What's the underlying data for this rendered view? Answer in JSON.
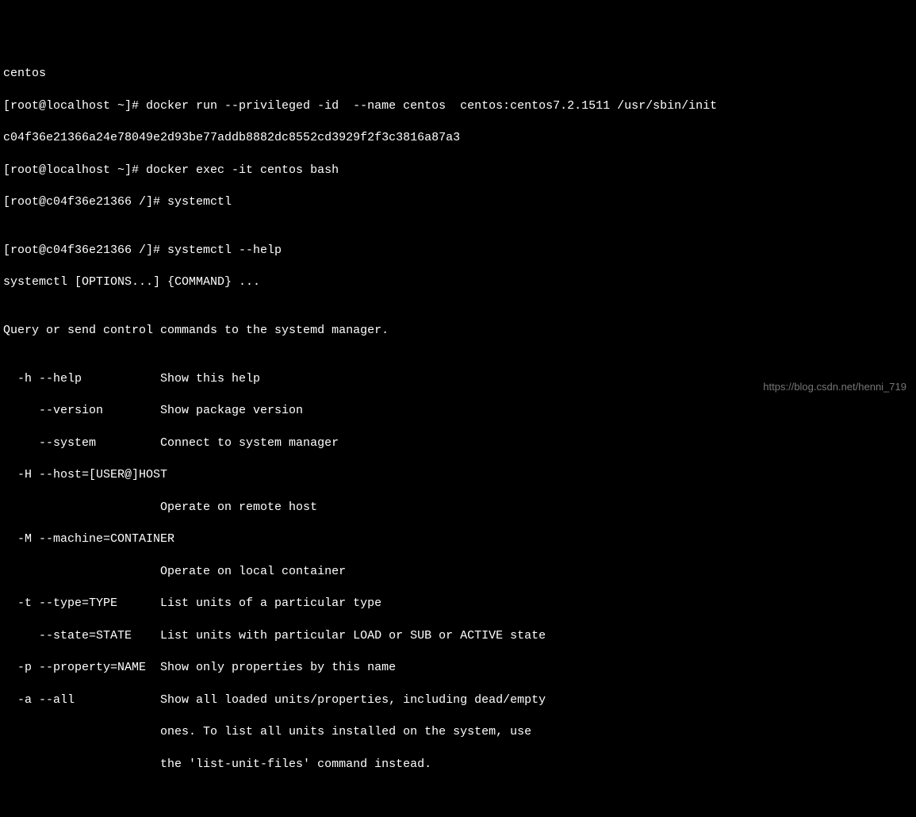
{
  "lines": {
    "l0": "centos",
    "l1": "[root@localhost ~]# docker run --privileged -id  --name centos  centos:centos7.2.1511 /usr/sbin/init",
    "l2": "c04f36e21366a24e78049e2d93be77addb8882dc8552cd3929f2f3c3816a87a3",
    "l3": "[root@localhost ~]# docker exec -it centos bash",
    "l4": "[root@c04f36e21366 /]# systemctl",
    "l5": "",
    "l6": "[root@c04f36e21366 /]# systemctl --help",
    "l7": "systemctl [OPTIONS...] {COMMAND} ...",
    "l8": "",
    "l9": "Query or send control commands to the systemd manager.",
    "l10": "",
    "l11": "  -h --help           Show this help",
    "l12": "     --version        Show package version",
    "l13": "     --system         Connect to system manager",
    "l14": "  -H --host=[USER@]HOST",
    "l15": "                      Operate on remote host",
    "l16": "  -M --machine=CONTAINER",
    "l17": "                      Operate on local container",
    "l18": "  -t --type=TYPE      List units of a particular type",
    "l19": "     --state=STATE    List units with particular LOAD or SUB or ACTIVE state",
    "l20": "  -p --property=NAME  Show only properties by this name",
    "l21": "  -a --all            Show all loaded units/properties, including dead/empty",
    "l22": "                      ones. To list all units installed on the system, use",
    "l23": "                      the 'list-unit-files' command instead."
  },
  "watermark": "https://blog.csdn.net/henni_719"
}
